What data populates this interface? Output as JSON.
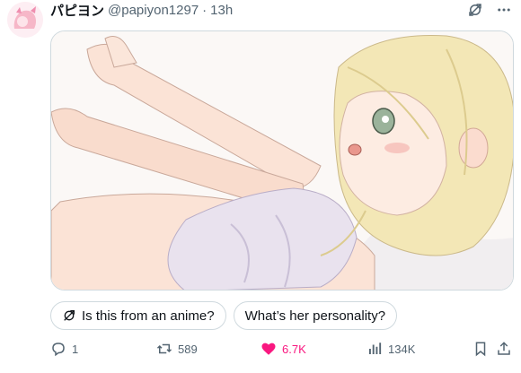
{
  "post": {
    "author_name": "パピヨン",
    "handle": "@papiyon1297",
    "separator": "·",
    "time": "13h"
  },
  "icons": {
    "grok": "grok-icon",
    "more": "more-icon",
    "reply": "reply-icon",
    "repost": "repost-icon",
    "like": "heart-icon",
    "views": "views-icon",
    "bookmark": "bookmark-icon",
    "share": "share-icon"
  },
  "chips": [
    {
      "label": "Is this from an anime?",
      "icon": "grok-icon"
    },
    {
      "label": "What’s her personality?"
    }
  ],
  "actions": {
    "replies": "1",
    "reposts": "589",
    "likes": "6.7K",
    "views": "134K"
  },
  "colors": {
    "like_active": "#f91880",
    "muted": "#536471",
    "border": "#cfd9de"
  }
}
